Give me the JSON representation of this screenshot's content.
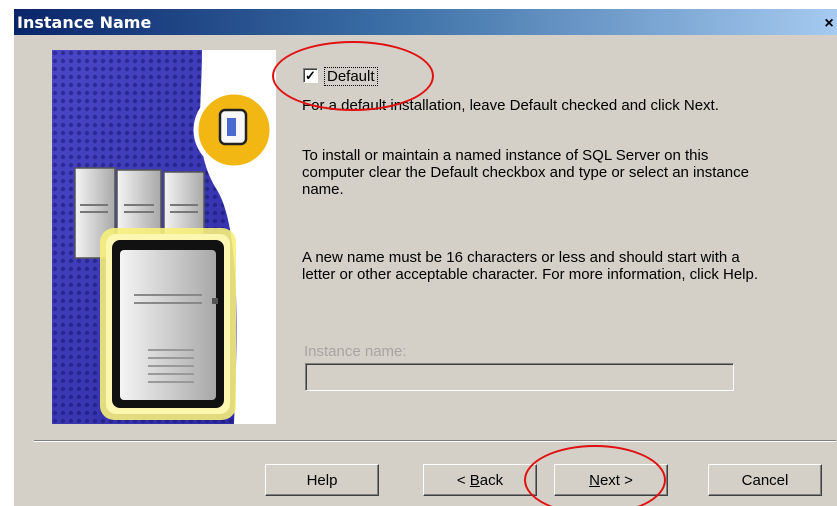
{
  "window": {
    "title": "Instance Name"
  },
  "default_checkbox": {
    "label": "Default",
    "checked": true,
    "mark": "✓"
  },
  "paragraphs": [
    "For a default installation, leave Default checked and click Next.",
    "To install or maintain a named instance of SQL Server on this computer clear the Default checkbox and type or select an instance name.",
    "A new name must be 16 characters or less and should start with a letter or other acceptable character.  For more information, click Help."
  ],
  "instance_name": {
    "label": "Instance name:",
    "value": "",
    "enabled": false
  },
  "buttons": {
    "help": "Help",
    "back": {
      "mnemonic": "B",
      "rest": "ack",
      "prefix": "< "
    },
    "next": {
      "mnemonic": "N",
      "rest": "ext >"
    },
    "cancel": "Cancel"
  },
  "annotation_color": "#e01010",
  "icons": [
    "close-icon",
    "checkmark-icon",
    "server-illustration",
    "database-icon"
  ]
}
